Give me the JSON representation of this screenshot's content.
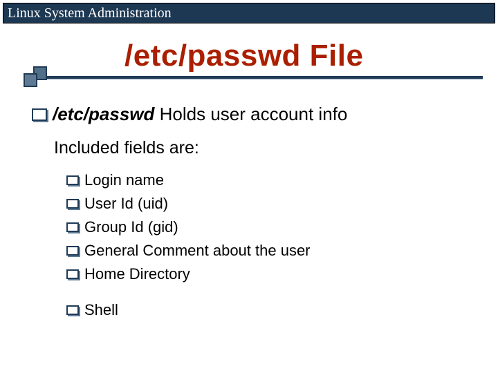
{
  "header": {
    "title": "Linux System Administration"
  },
  "slide": {
    "title": "/etc/passwd File",
    "main_bullet": {
      "emph": "/etc/passwd",
      "rest": " Holds user account info"
    },
    "sub_line": "Included fields are:",
    "fields": [
      "Login name",
      "User Id (uid)",
      "Group Id (gid)",
      "General Comment about the user",
      "Home Directory",
      "Shell"
    ]
  }
}
